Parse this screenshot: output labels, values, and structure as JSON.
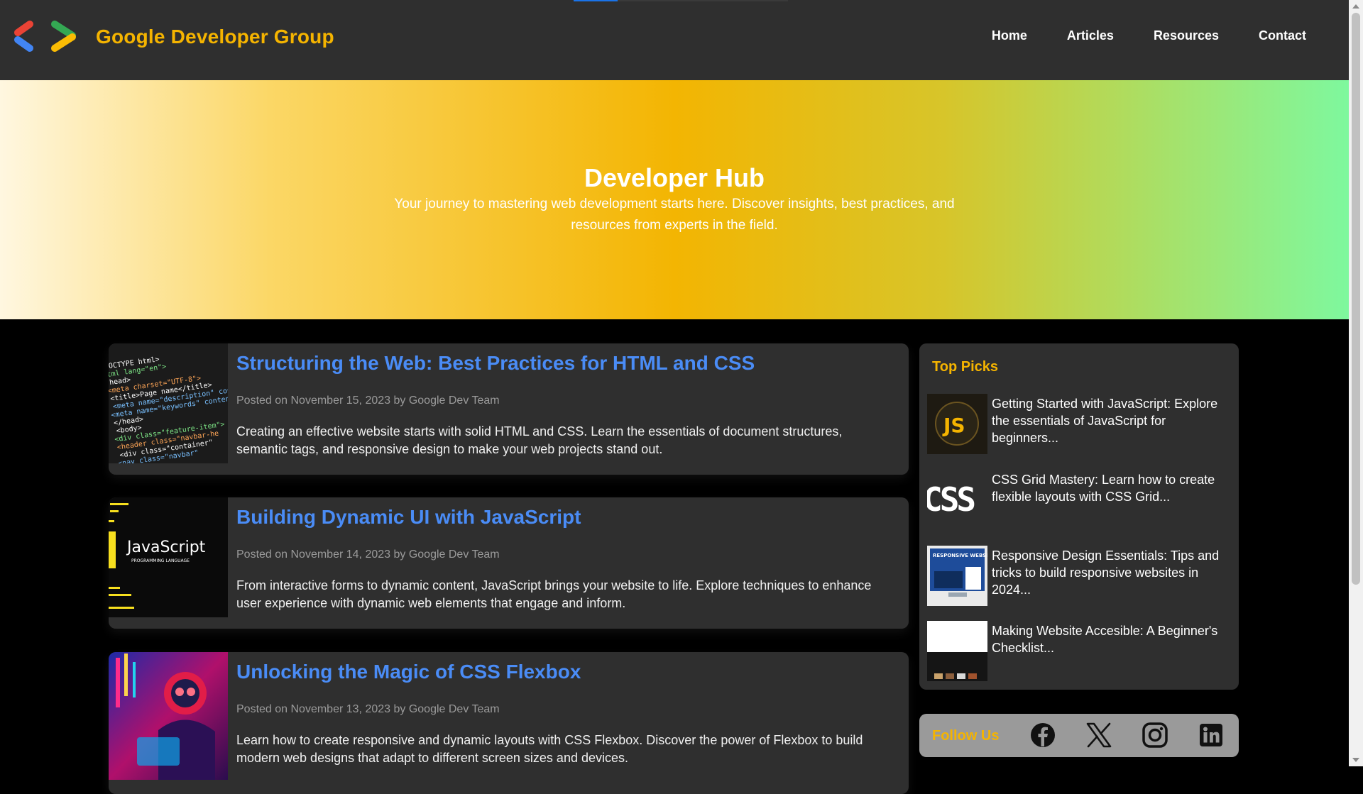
{
  "header": {
    "brand": "Google Developer Group",
    "nav": [
      "Home",
      "Articles",
      "Resources",
      "Contact"
    ]
  },
  "hero": {
    "title": "Developer Hub",
    "subtitle": "Your journey to mastering web development starts here. Discover insights, best practices, and resources from experts in the field."
  },
  "articles": [
    {
      "title": "Structuring the Web: Best Practices for HTML and CSS",
      "meta": "Posted on November 15, 2023 by Google Dev Team",
      "excerpt": "Creating an effective website starts with solid HTML and CSS. Learn the essentials of document structures, semantic tags, and responsive design to make your web projects stand out.",
      "thumb_lines": [
        "DOCTYPE html>",
        "tml lang=\"en\">",
        "head>",
        " <meta charset=\"UTF-8\">",
        " <title>Page name</title>",
        " <meta name=\"description\" con",
        " <meta name=\"keywords\" conten",
        "</head>",
        "<body>",
        " <div class=\"feature-item\">",
        "  <header class=\"navbar-he",
        "   <div class=\"container\"",
        "    <nav class=\"navbar\""
      ]
    },
    {
      "title": "Building Dynamic UI with JavaScript",
      "meta": "Posted on November 14, 2023 by Google Dev Team",
      "excerpt": "From interactive forms to dynamic content, JavaScript brings your website to life. Explore techniques to enhance user experience with dynamic web elements that engage and inform.",
      "thumb_title": "JavaScript",
      "thumb_sub": "PROGRAMMING LANGUAGE"
    },
    {
      "title": "Unlocking the Magic of CSS Flexbox",
      "meta": "Posted on November 13, 2023 by Google Dev Team",
      "excerpt": "Learn how to create responsive and dynamic layouts with CSS Flexbox. Discover the power of Flexbox to build modern web designs that adapt to different screen sizes and devices."
    }
  ],
  "sidebar": {
    "top_picks_title": "Top Picks",
    "picks": [
      {
        "text": "Getting Started with JavaScript: Explore the essentials of JavaScript for beginners...",
        "thumb_label": "JS"
      },
      {
        "text": "CSS Grid Mastery: Learn how to create flexible layouts with CSS Grid...",
        "thumb_label": "CSS"
      },
      {
        "text": "Responsive Design Essentials: Tips and tricks to build responsive websites in 2024...",
        "thumb_label": "RESPONSIVE WEBSITE DESIGN"
      },
      {
        "text": "Making Website Accesible: A Beginner's Checklist...",
        "thumb_label": ""
      }
    ],
    "follow_label": "Follow Us",
    "social": [
      "facebook-icon",
      "x-icon",
      "instagram-icon",
      "linkedin-icon"
    ]
  },
  "colors": {
    "brand": "#f5b400",
    "link": "#4a8cf6",
    "card": "#2f2f2f"
  }
}
